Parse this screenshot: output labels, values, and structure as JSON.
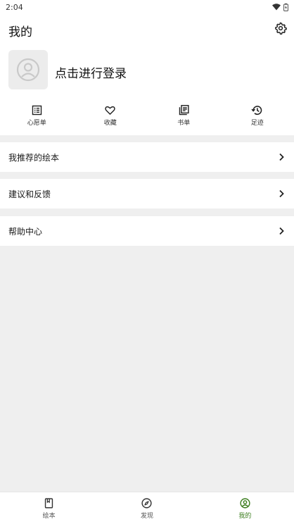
{
  "status": {
    "time": "2:04",
    "wifi_icon": "wifi-icon",
    "battery_icon": "battery-icon"
  },
  "header": {
    "title": "我的",
    "settings_icon": "gear-icon"
  },
  "profile": {
    "login_text": "点击进行登录",
    "avatar_icon": "avatar-placeholder-icon"
  },
  "shortcuts": [
    {
      "label": "心愿单",
      "icon": "list-icon"
    },
    {
      "label": "收藏",
      "icon": "heart-icon"
    },
    {
      "label": "书单",
      "icon": "booklist-icon"
    },
    {
      "label": "足迹",
      "icon": "history-icon"
    }
  ],
  "menu": [
    {
      "label": "我推荐的绘本",
      "icon": "chevron-right-icon"
    },
    {
      "label": "建议和反馈",
      "icon": "chevron-right-icon"
    },
    {
      "label": "帮助中心",
      "icon": "chevron-right-icon"
    }
  ],
  "bottom_nav": [
    {
      "label": "绘本",
      "icon": "book-icon",
      "active": false
    },
    {
      "label": "发现",
      "icon": "compass-icon",
      "active": false
    },
    {
      "label": "我的",
      "icon": "profile-icon",
      "active": true
    }
  ],
  "colors": {
    "accent": "#3b7d1d",
    "background": "#efefef",
    "surface": "#ffffff"
  }
}
